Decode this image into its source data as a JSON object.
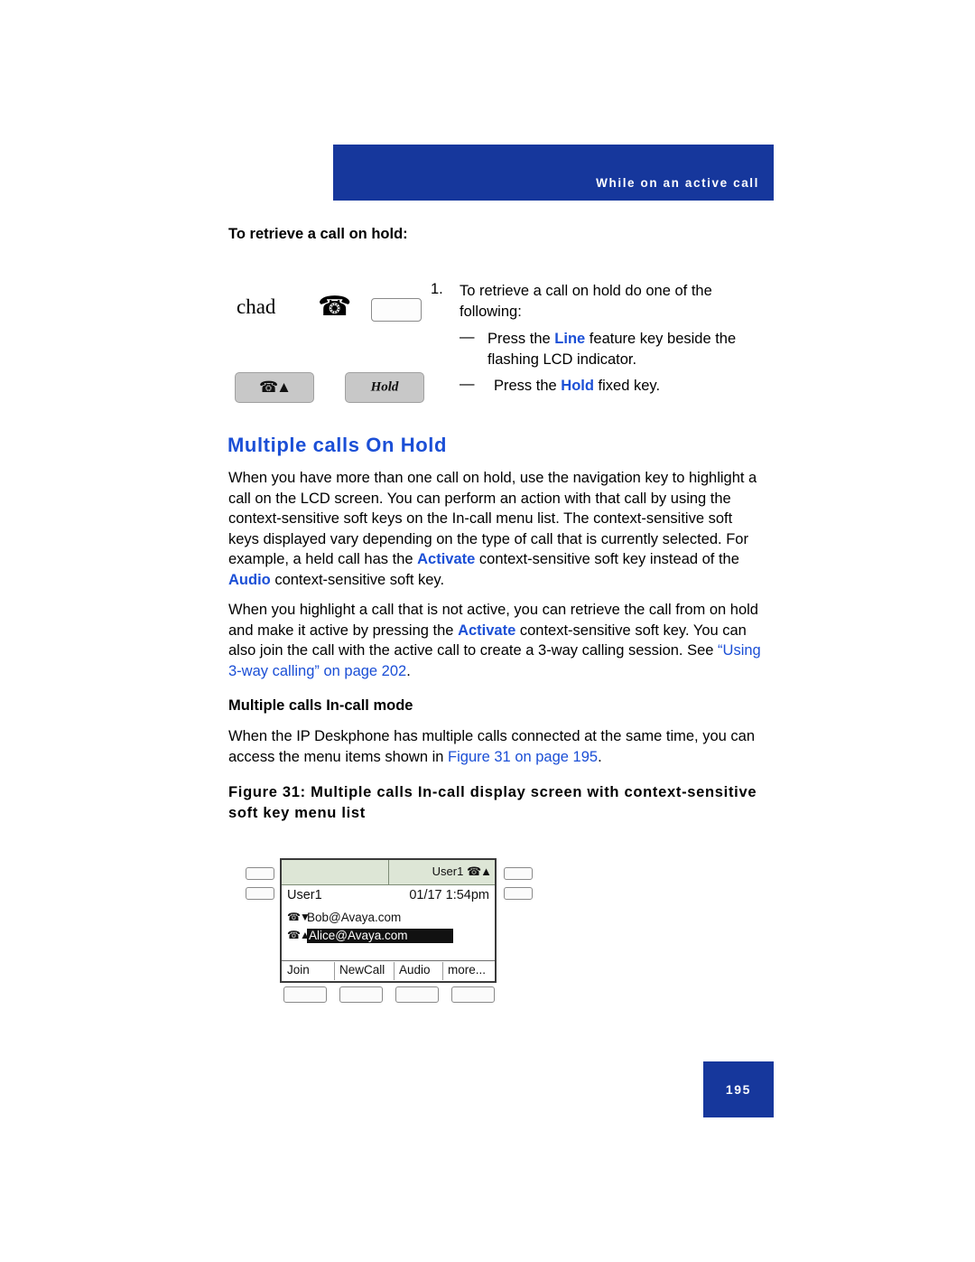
{
  "header": {
    "running_head": "While on an active call"
  },
  "sections": {
    "retrieve_heading": "To retrieve a call on hold:",
    "step1_number": "1.",
    "step1_text": "To retrieve a call on hold do one of the following:",
    "bullet1_dash": "—",
    "bullet1_pre": "Press the ",
    "bullet1_key": "Line",
    "bullet1_post": " feature key beside the flashing LCD indicator.",
    "bullet2_dash": "—",
    "bullet2_pre": "Press the ",
    "bullet2_key": "Hold",
    "bullet2_post": " fixed key.",
    "chad_label": "chad",
    "hold_key_label": "Hold"
  },
  "multiple_calls": {
    "title": "Multiple calls On Hold",
    "para1_a": "When you have more than one call on hold, use the navigation key to highlight a call on the LCD screen. You can perform an action with that call by using the context-sensitive soft keys on the In-call menu list. The context-sensitive soft keys displayed vary depending on the type of call that is currently selected. For example, a held call has the ",
    "para1_b": "Activate",
    "para1_c": " context-sensitive soft key instead of the ",
    "para1_d": "Audio",
    "para1_e": " context-sensitive soft key.",
    "para2_a": "When you highlight a call that is not active, you can retrieve the call from on hold and make it active by pressing the ",
    "para2_b": "Activate",
    "para2_c": " context-sensitive soft key. You can also join the call with the active call to create a 3-way calling session. See ",
    "para2_link": "“Using 3-way calling” on page 202",
    "para2_d": ".",
    "subheading": "Multiple calls In-call mode",
    "para3_a": "When the IP Deskphone has multiple calls connected at the same time, you can access the menu items shown in ",
    "para3_link": "Figure 31 on page 195",
    "para3_b": "."
  },
  "figure": {
    "caption": "Figure 31: Multiple calls In-call display screen with context-sensitive soft key menu list",
    "display": {
      "tab_label": "User1",
      "tab_icon": "handset-icon",
      "user": "User1",
      "datetime": "01/17 1:54pm",
      "calls": [
        {
          "icon": "handset-down-icon",
          "label": "Bob@Avaya.com",
          "selected": false
        },
        {
          "icon": "handset-hold-icon",
          "label": "Alice@Avaya.com",
          "selected": true
        }
      ],
      "softkeys": [
        "Join",
        "NewCall",
        "Audio",
        "more..."
      ]
    }
  },
  "footer": {
    "page_number": "195"
  },
  "colors": {
    "brand_blue": "#16379c",
    "link_blue": "#1b4fd6"
  }
}
